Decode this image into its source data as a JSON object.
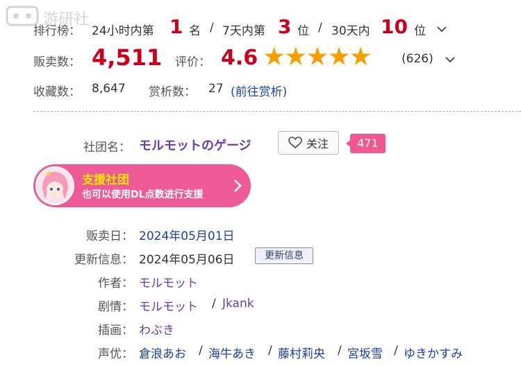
{
  "watermark": "游研社",
  "ranking": {
    "label": "排行榜：",
    "p24_prefix": "24小时内第",
    "p24_rank": "1",
    "p24_suffix": "名",
    "sep": "/",
    "p7_prefix": "7天内第",
    "p7_rank": "3",
    "p7_suffix": "位",
    "p30_prefix": "30天内",
    "p30_rank": "10",
    "p30_suffix": "位"
  },
  "sales": {
    "label": "贩卖数：",
    "value": "4,511"
  },
  "rating": {
    "label": "评价：",
    "score": "4.6",
    "stars": "★★★★★",
    "count": "(626)",
    "value": 4.6
  },
  "favorites": {
    "label": "收藏数：",
    "value": "8,647",
    "reviews_label": "赏析数：",
    "reviews_value": "27",
    "reviews_link": "(前往赏析)"
  },
  "circle": {
    "label": "社团名：",
    "name": "モルモットのゲージ",
    "follow_label": "关注",
    "follow_count": "471"
  },
  "support": {
    "title": "支援社团",
    "subtitle": "也可以使用DL点数进行支援"
  },
  "details": {
    "release_label": "贩卖日：",
    "release_value": "2024年05月01日",
    "update_label": "更新信息：",
    "update_value": "2024年05月06日",
    "update_button": "更新信息",
    "author_label": "作者：",
    "author_value": "モルモット",
    "scenario_label": "剧情：",
    "scenario_1": "モルモット",
    "scenario_2": "Jkank",
    "illust_label": "插画：",
    "illust_value": "わぶき",
    "voice_label": "声优：",
    "voice_actors": [
      "倉浪あお",
      "海牛あき",
      "藤村莉央",
      "宮坂雪",
      "ゆきかすみ"
    ]
  },
  "colors": {
    "accent_red": "#c8001e",
    "star": "#f5a000",
    "pink": "#ee5a95",
    "link": "#1a3ea8"
  }
}
